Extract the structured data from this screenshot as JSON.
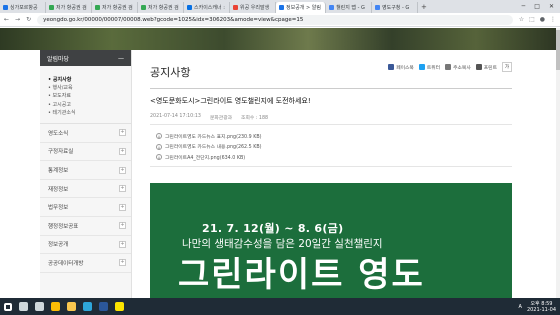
{
  "browser": {
    "tabs": [
      {
        "label": "싱가포르항공",
        "color": "#1a73e8"
      },
      {
        "label": "저가 항공권 검",
        "color": "#34a853"
      },
      {
        "label": "저가 항공권 검",
        "color": "#34a853"
      },
      {
        "label": "저가 항공권 검",
        "color": "#34a853"
      },
      {
        "label": "스카이스캐너 :",
        "color": "#0770e3"
      },
      {
        "label": "위공 우리말생",
        "color": "#ea4335"
      },
      {
        "label": "정보공개 > 알림",
        "color": "#1a73e8"
      },
      {
        "label": "챌린지 맵 - G",
        "color": "#4285f4"
      },
      {
        "label": "영도구청 - G",
        "color": "#4285f4"
      }
    ],
    "active_tab": 6,
    "url": "yeongdo.go.kr/00000/00007/00008.web?gcode=1025&idx=306203&amode=view&cpage=15",
    "window_controls": [
      "─",
      "□",
      "✕"
    ]
  },
  "sidebar": {
    "header": "알림마당",
    "header_icon": "—",
    "subitems": [
      {
        "label": "• 공지사항",
        "active": true
      },
      {
        "label": "• 행사/교육",
        "active": false
      },
      {
        "label": "• 보도자료",
        "active": false
      },
      {
        "label": "• 고시공고",
        "active": false
      },
      {
        "label": "• 테기관소식",
        "active": false
      }
    ],
    "items": [
      "영도소식",
      "구정자료실",
      "통계정보",
      "재정정보",
      "법무정보",
      "행정정보공표",
      "정보공개",
      "공공데이터개방"
    ]
  },
  "main": {
    "page_title": "공지사항",
    "tools": [
      {
        "label": "페이스북",
        "color": "#3b5998"
      },
      {
        "label": "트위터",
        "color": "#1da1f2"
      },
      {
        "label": "주소복사",
        "color": "#777777"
      },
      {
        "label": "프린트",
        "color": "#555555"
      }
    ],
    "zoom_label": "가",
    "post_title": "<영도문화도시>그린라이트 영도챌린지에 도전하세요!",
    "meta": {
      "date": "2021-07-14 17:10:13",
      "dept": "문화관광과",
      "views": "조회수 : 188"
    },
    "files": [
      "그린라이트영도 카드뉴스 표지.png(230.9 KB)",
      "그린라이트영도 카드뉴스 내용.png(262.5 KB)",
      "그린라이트A4_전단지.png(634.0 KB)"
    ],
    "poster": {
      "date": "21. 7. 12(월) ~ 8. 6(금)",
      "subtitle": "나만의 생태감수성을 담은 20일간 실천챌린지",
      "big": "그린라이트 영도"
    }
  },
  "taskbar": {
    "apps": [
      {
        "name": "windows-icon",
        "color": "#ffffff"
      },
      {
        "name": "search-icon",
        "color": "#cfd8dc"
      },
      {
        "name": "taskview-icon",
        "color": "#cfd8dc"
      },
      {
        "name": "chrome-icon",
        "color": "#fbbc05"
      },
      {
        "name": "folder-icon",
        "color": "#f9c74f"
      },
      {
        "name": "edge-icon",
        "color": "#2ea6d9"
      },
      {
        "name": "word-icon",
        "color": "#2b579a"
      },
      {
        "name": "kakaotalk-icon",
        "color": "#fee500"
      }
    ],
    "tray_lang": "A",
    "time": "오후 8:59",
    "date": "2021-11-04"
  }
}
